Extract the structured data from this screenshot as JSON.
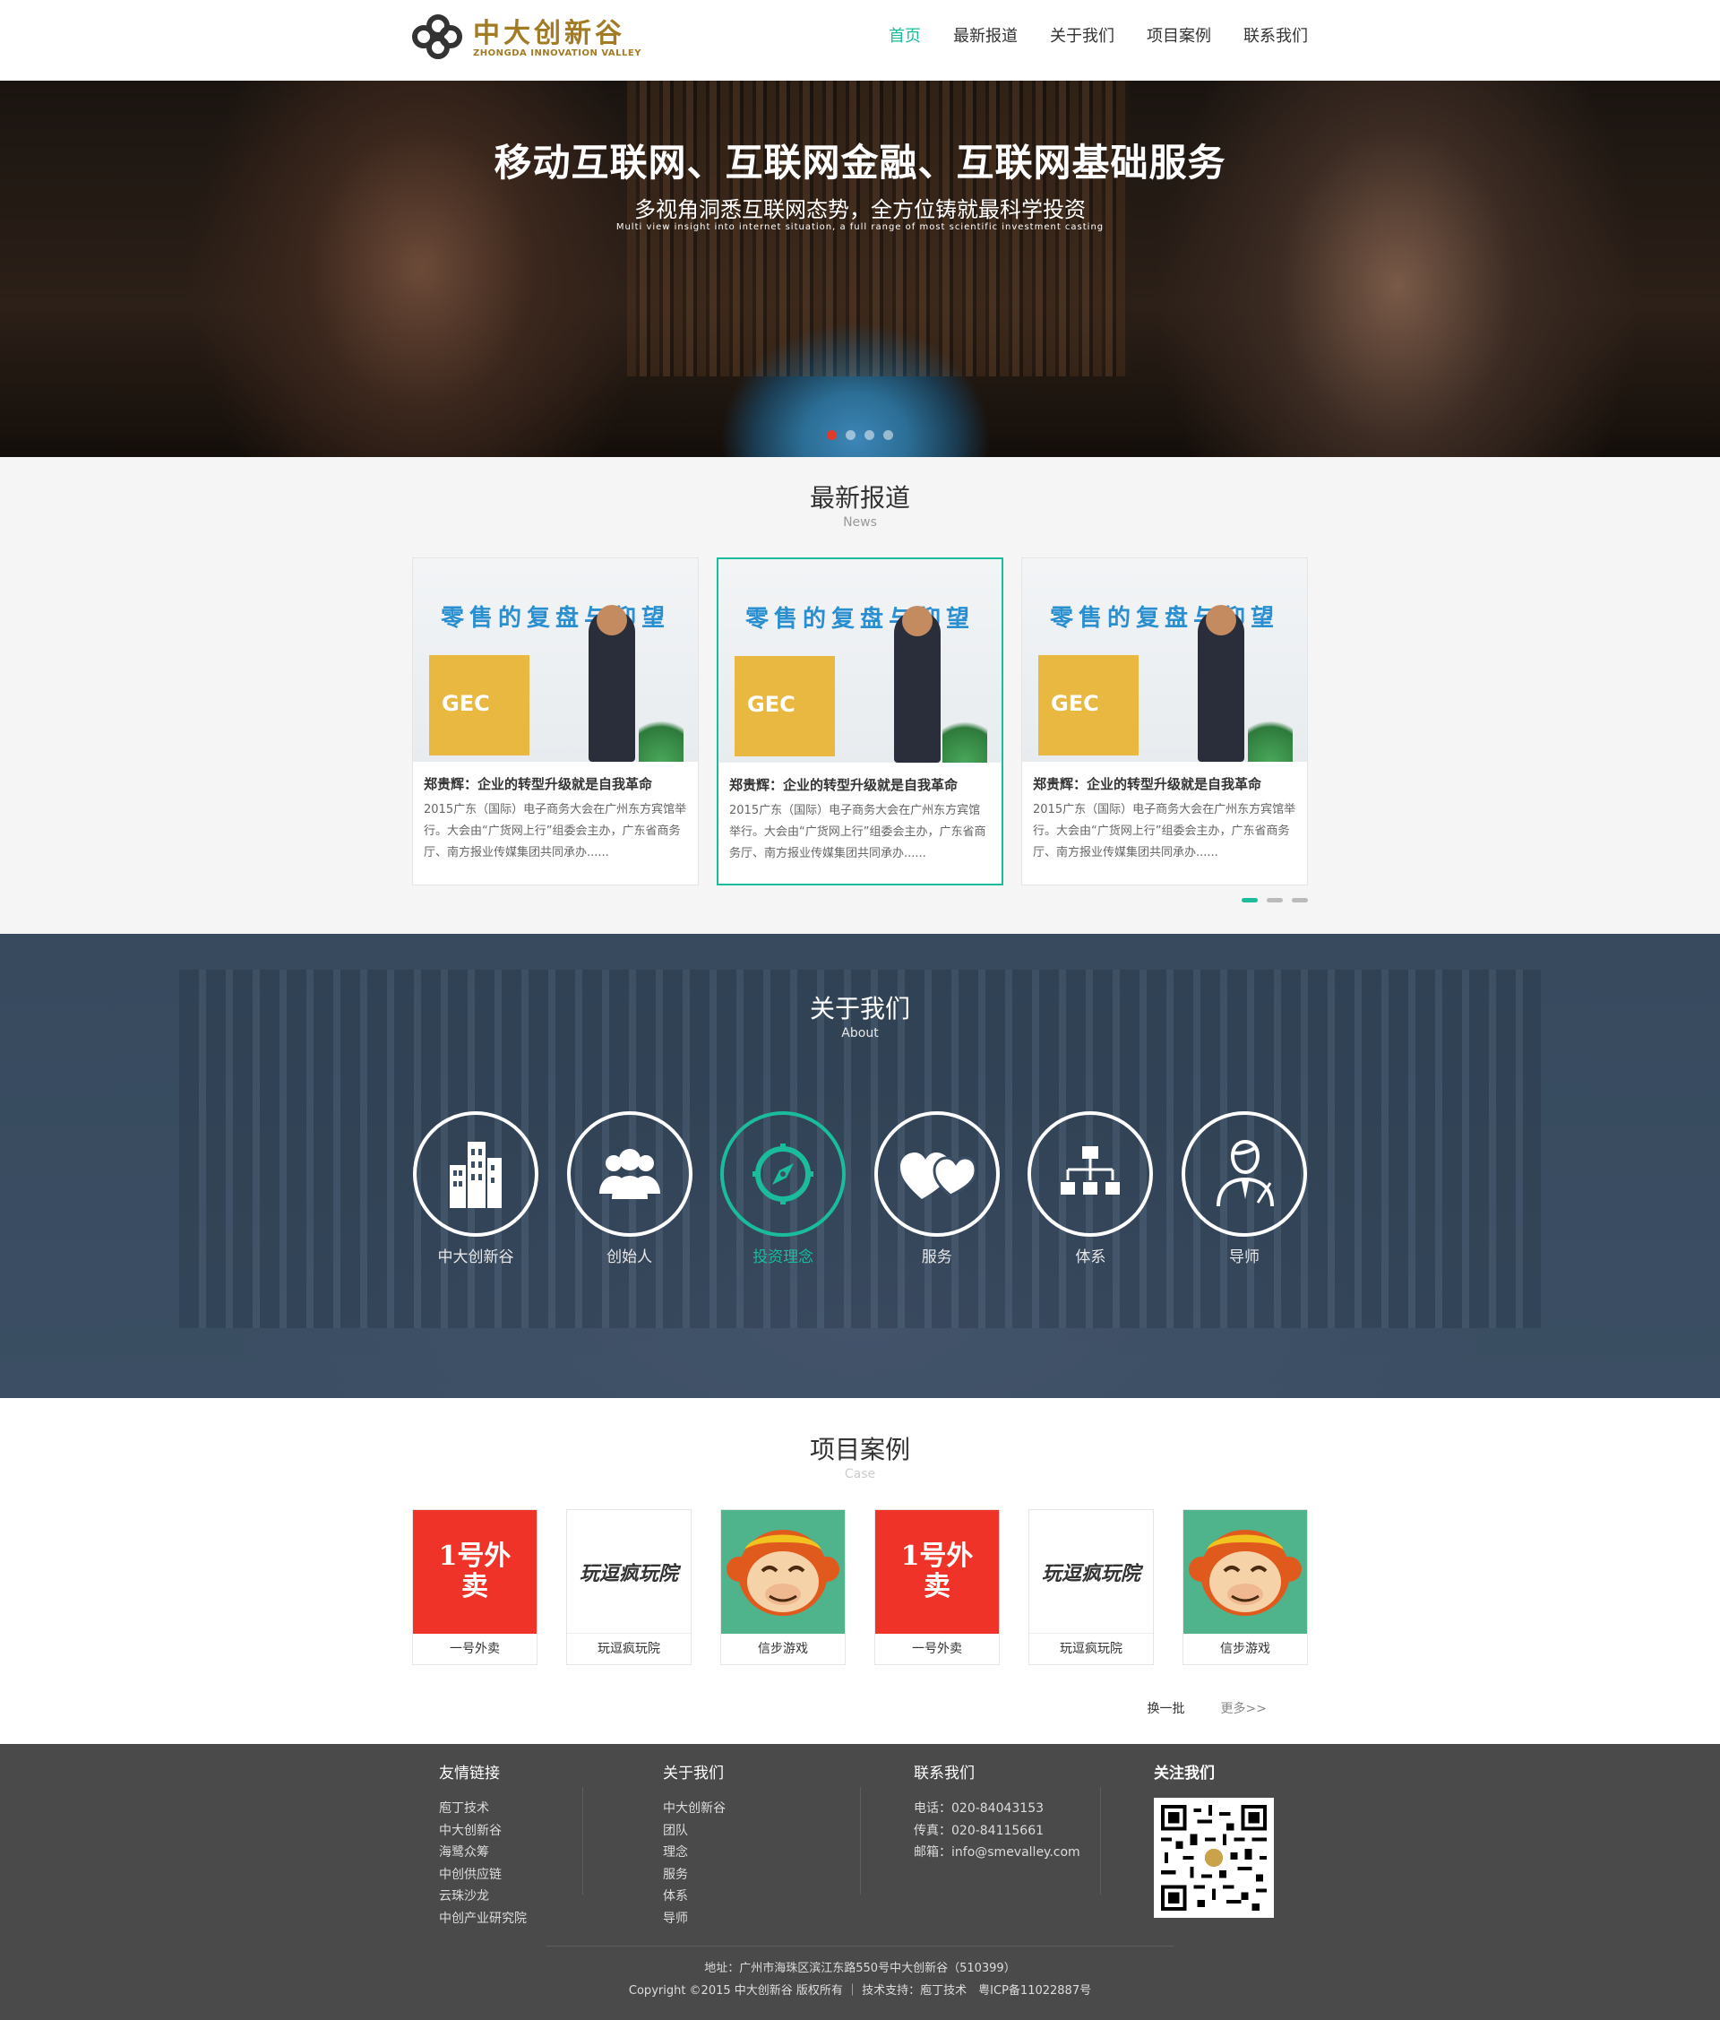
{
  "header": {
    "logo_cn": "中大创新谷",
    "logo_en": "ZHONGDA INNOVATION VALLEY",
    "nav": [
      "首页",
      "最新报道",
      "关于我们",
      "项目案例",
      "联系我们"
    ],
    "nav_active": 0
  },
  "banner": {
    "title": "移动互联网、互联网金融、互联网基础服务",
    "subtitle": "多视角洞悉互联网态势，全方位铸就最科学投资",
    "subtitle_en": "Multi view insight into internet situation, a full range of most scientific investment casting",
    "slide_count": 4,
    "active_slide": 0
  },
  "news": {
    "title": "最新报道",
    "title_en": "News",
    "cards": [
      {
        "image_text": "零售的复盘与仰望",
        "title": "郑贵辉：企业的转型升级就是自我革命",
        "desc": "2015广东（国际）电子商务大会在广州东方宾馆举行。大会由“广货网上行”组委会主办，广东省商务厅、南方报业传媒集团共同承办......"
      },
      {
        "image_text": "零售的复盘与仰望",
        "title": "郑贵辉：企业的转型升级就是自我革命",
        "desc": "2015广东（国际）电子商务大会在广州东方宾馆举行。大会由“广货网上行”组委会主办，广东省商务厅、南方报业传媒集团共同承办......"
      },
      {
        "image_text": "零售的复盘与仰望",
        "title": "郑贵辉：企业的转型升级就是自我革命",
        "desc": "2015广东（国际）电子商务大会在广州东方宾馆举行。大会由“广货网上行”组委会主办，广东省商务厅、南方报业传媒集团共同承办......"
      }
    ],
    "selected_card": 1,
    "pages": 3,
    "active_page": 0
  },
  "about": {
    "title": "关于我们",
    "title_en": "About",
    "items": [
      {
        "label": "中大创新谷",
        "icon": "buildings-icon"
      },
      {
        "label": "创始人",
        "icon": "team-icon"
      },
      {
        "label": "投资理念",
        "icon": "compass-icon"
      },
      {
        "label": "服务",
        "icon": "hearts-icon"
      },
      {
        "label": "体系",
        "icon": "org-chart-icon"
      },
      {
        "label": "导师",
        "icon": "mentor-icon"
      }
    ],
    "active_item": 2
  },
  "cases": {
    "title": "项目案例",
    "title_en": "Case",
    "items": [
      {
        "label": "一号外卖",
        "logo": "1号外卖"
      },
      {
        "label": "玩逗疯玩院",
        "logo": "玩逗疯玩院"
      },
      {
        "label": "信步游戏",
        "logo": ""
      },
      {
        "label": "一号外卖",
        "logo": "1号外卖"
      },
      {
        "label": "玩逗疯玩院",
        "logo": "玩逗疯玩院"
      },
      {
        "label": "信步游戏",
        "logo": ""
      }
    ],
    "swap_label": "换一批",
    "more_label": "更多>>"
  },
  "footer": {
    "links_title": "友情链接",
    "links": [
      "庖丁技术",
      "中大创新谷",
      "海鹭众筹",
      "中创供应链",
      "云珠沙龙",
      "中创产业研究院"
    ],
    "about_title": "关于我们",
    "about_links": [
      "中大创新谷",
      "团队",
      "理念",
      "服务",
      "体系",
      "导师"
    ],
    "contact_title": "联系我们",
    "contact": [
      "电话：020-84043153",
      "传真：020-84115661",
      "邮箱：info@smevalley.com"
    ],
    "follow_title": "关注我们",
    "address": "地址：广州市海珠区滨江东路550号中大创新谷（510399）",
    "copyright": "Copyright ©2015 中大创新谷 版权所有 ｜ 技术支持：庖丁技术　粤ICP备11022887号"
  },
  "colors": {
    "accent": "#1abc9c",
    "footer_bg": "#4a4a4a",
    "about_bg": "#3b4e63"
  }
}
